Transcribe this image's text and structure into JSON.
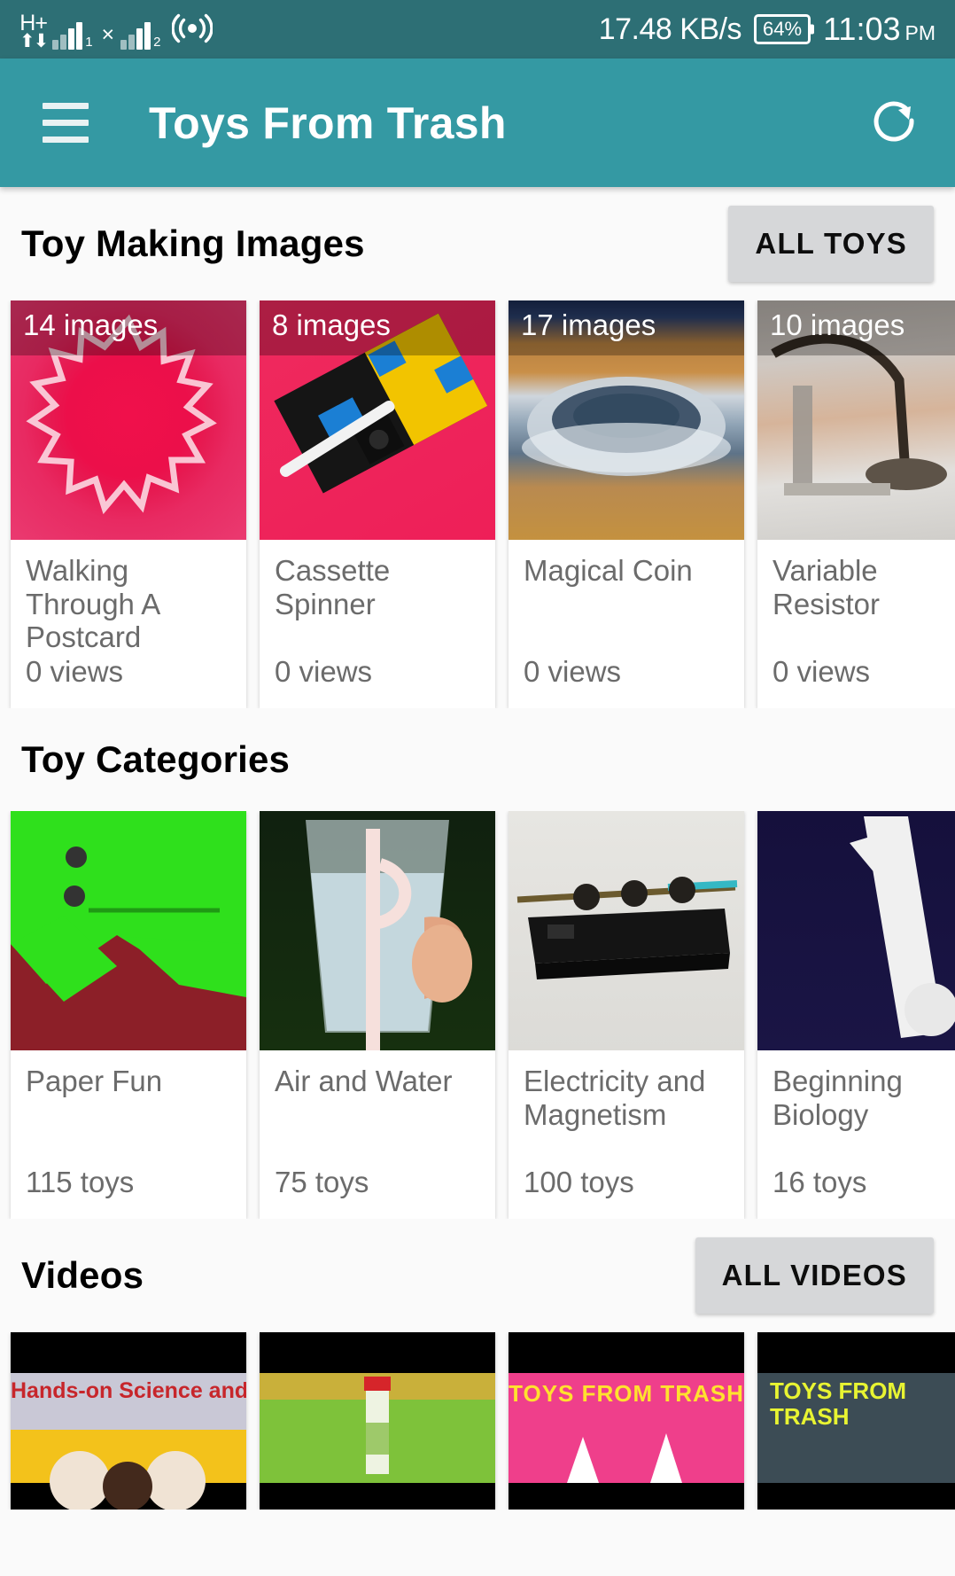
{
  "status_bar": {
    "network_type": "H+",
    "sim1_label": "1",
    "sim2_label": "2",
    "x_mark": "×",
    "net_speed": "17.48 KB/s",
    "battery": "64%",
    "time": "11:03",
    "ampm": "PM"
  },
  "app_bar": {
    "menu_icon": "hamburger-icon",
    "title": "Toys From Trash",
    "refresh_icon": "refresh-icon"
  },
  "sections": {
    "images": {
      "title": "Toy Making Images",
      "action_label": "ALL TOYS",
      "cards": [
        {
          "count": "14 images",
          "title": "Walking Through A Postcard",
          "meta": "0 views",
          "art": "art-postcard"
        },
        {
          "count": "8 images",
          "title": "Cassette Spinner",
          "meta": "0 views",
          "art": "art-cassette"
        },
        {
          "count": "17 images",
          "title": "Magical Coin",
          "meta": "0 views",
          "art": "art-coin"
        },
        {
          "count": "10 images",
          "title": "Variable Resistor",
          "meta": "0 views",
          "art": "art-variable"
        }
      ]
    },
    "categories": {
      "title": "Toy Categories",
      "cards": [
        {
          "title": "Paper Fun",
          "meta": "115 toys",
          "art": "art-paper"
        },
        {
          "title": "Air and Water",
          "meta": "75 toys",
          "art": "art-water"
        },
        {
          "title": "Electricity and Magnetism",
          "meta": "100 toys",
          "art": "art-elec"
        },
        {
          "title": "Beginning Biology",
          "meta": "16 toys",
          "art": "art-bio"
        }
      ]
    },
    "videos": {
      "title": "Videos",
      "action_label": "ALL VIDEOS",
      "cards": [
        {
          "caption": "Hands-on Science and Maths",
          "caption_color": "#c7262b",
          "band_color": "#c9c8d6"
        },
        {
          "caption": "",
          "caption_color": "#ffffff",
          "band_color": "#7ec23a"
        },
        {
          "caption": "TOYS FROM TRASH",
          "caption_color": "#ffe22e",
          "band_color": "#ef3f8b"
        },
        {
          "caption": "TOYS FROM TRASH",
          "caption_color": "#e8f432",
          "band_color": "#3c4c55"
        }
      ]
    }
  },
  "colors": {
    "status_bar_bg": "#2d6f75",
    "app_bar_bg": "#3499a3",
    "page_bg": "#fafafa",
    "card_bg": "#ffffff",
    "button_bg": "#d6d7d9",
    "secondary_text": "#6b6b6b"
  }
}
